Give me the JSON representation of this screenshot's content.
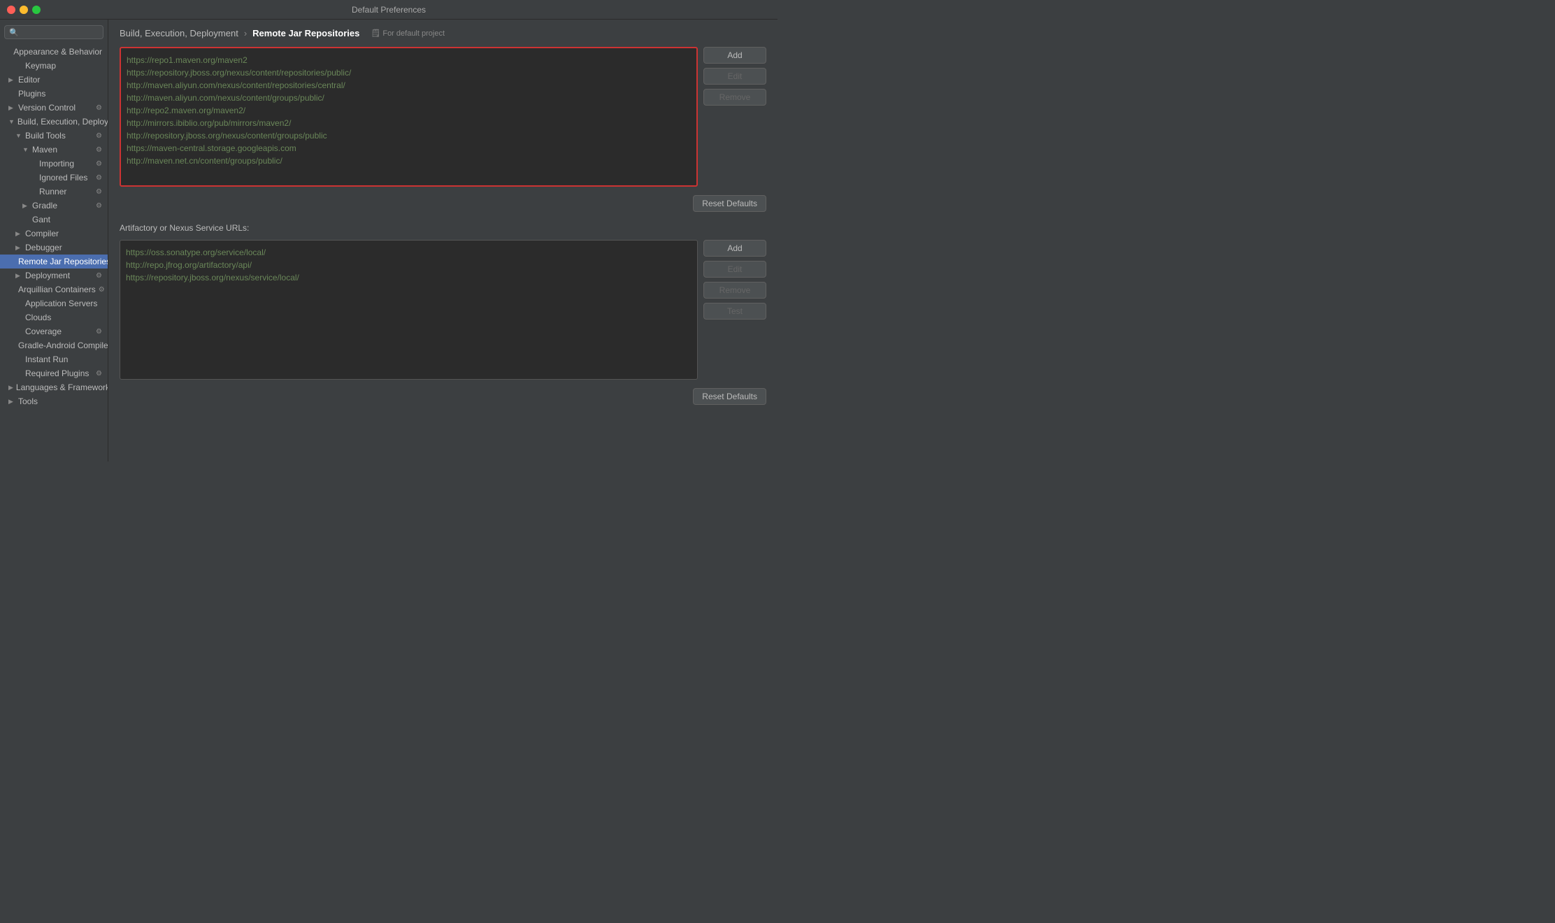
{
  "window": {
    "title": "Default Preferences"
  },
  "breadcrumb": {
    "parent": "Build, Execution, Deployment",
    "separator": "›",
    "current": "Remote Jar Repositories",
    "project_label": "🗒 For default project"
  },
  "sidebar": {
    "search_placeholder": "🔍",
    "items": [
      {
        "id": "appearance",
        "label": "Appearance & Behavior",
        "indent": 0,
        "arrow": "",
        "has_gear": false,
        "selected": false
      },
      {
        "id": "keymap",
        "label": "Keymap",
        "indent": 1,
        "arrow": "",
        "has_gear": false,
        "selected": false
      },
      {
        "id": "editor",
        "label": "Editor",
        "indent": 0,
        "arrow": "▶",
        "has_gear": false,
        "selected": false
      },
      {
        "id": "plugins",
        "label": "Plugins",
        "indent": 0,
        "arrow": "",
        "has_gear": false,
        "selected": false
      },
      {
        "id": "version-control",
        "label": "Version Control",
        "indent": 0,
        "arrow": "▶",
        "has_gear": true,
        "selected": false
      },
      {
        "id": "build-exec-deploy",
        "label": "Build, Execution, Deployment",
        "indent": 0,
        "arrow": "▼",
        "has_gear": false,
        "selected": false
      },
      {
        "id": "build-tools",
        "label": "Build Tools",
        "indent": 1,
        "arrow": "▼",
        "has_gear": true,
        "selected": false
      },
      {
        "id": "maven",
        "label": "Maven",
        "indent": 2,
        "arrow": "▼",
        "has_gear": true,
        "selected": false
      },
      {
        "id": "importing",
        "label": "Importing",
        "indent": 3,
        "arrow": "",
        "has_gear": true,
        "selected": false
      },
      {
        "id": "ignored-files",
        "label": "Ignored Files",
        "indent": 3,
        "arrow": "",
        "has_gear": true,
        "selected": false
      },
      {
        "id": "runner",
        "label": "Runner",
        "indent": 3,
        "arrow": "",
        "has_gear": true,
        "selected": false
      },
      {
        "id": "gradle",
        "label": "Gradle",
        "indent": 2,
        "arrow": "▶",
        "has_gear": true,
        "selected": false
      },
      {
        "id": "gant",
        "label": "Gant",
        "indent": 2,
        "arrow": "",
        "has_gear": false,
        "selected": false
      },
      {
        "id": "compiler",
        "label": "Compiler",
        "indent": 1,
        "arrow": "▶",
        "has_gear": false,
        "selected": false
      },
      {
        "id": "debugger",
        "label": "Debugger",
        "indent": 1,
        "arrow": "▶",
        "has_gear": false,
        "selected": false
      },
      {
        "id": "remote-jar",
        "label": "Remote Jar Repositories",
        "indent": 1,
        "arrow": "",
        "has_gear": true,
        "selected": true
      },
      {
        "id": "deployment",
        "label": "Deployment",
        "indent": 1,
        "arrow": "▶",
        "has_gear": true,
        "selected": false
      },
      {
        "id": "arquillian",
        "label": "Arquillian Containers",
        "indent": 1,
        "arrow": "",
        "has_gear": true,
        "selected": false
      },
      {
        "id": "app-servers",
        "label": "Application Servers",
        "indent": 1,
        "arrow": "",
        "has_gear": false,
        "selected": false
      },
      {
        "id": "clouds",
        "label": "Clouds",
        "indent": 1,
        "arrow": "",
        "has_gear": false,
        "selected": false
      },
      {
        "id": "coverage",
        "label": "Coverage",
        "indent": 1,
        "arrow": "",
        "has_gear": true,
        "selected": false
      },
      {
        "id": "gradle-android",
        "label": "Gradle-Android Compiler",
        "indent": 1,
        "arrow": "",
        "has_gear": true,
        "selected": false
      },
      {
        "id": "instant-run",
        "label": "Instant Run",
        "indent": 1,
        "arrow": "",
        "has_gear": false,
        "selected": false
      },
      {
        "id": "required-plugins",
        "label": "Required Plugins",
        "indent": 1,
        "arrow": "",
        "has_gear": true,
        "selected": false
      },
      {
        "id": "languages",
        "label": "Languages & Frameworks",
        "indent": 0,
        "arrow": "▶",
        "has_gear": false,
        "selected": false
      },
      {
        "id": "tools",
        "label": "Tools",
        "indent": 0,
        "arrow": "▶",
        "has_gear": false,
        "selected": false
      }
    ]
  },
  "repo_section": {
    "urls": [
      "https://repo1.maven.org/maven2",
      "https://repository.jboss.org/nexus/content/repositories/public/",
      "http://maven.aliyun.com/nexus/content/repositories/central/",
      "http://maven.aliyun.com/nexus/content/groups/public/",
      "http://repo2.maven.org/maven2/",
      "http://mirrors.ibiblio.org/pub/mirrors/maven2/",
      "http://repository.jboss.org/nexus/content/groups/public",
      "https://maven-central.storage.googleapis.com",
      "http://maven.net.cn/content/groups/public/"
    ],
    "buttons": {
      "add": "Add",
      "edit": "Edit",
      "remove": "Remove",
      "reset_defaults": "Reset Defaults"
    }
  },
  "artifactory_section": {
    "label": "Artifactory or Nexus Service URLs:",
    "urls": [
      "https://oss.sonatype.org/service/local/",
      "http://repo.jfrog.org/artifactory/api/",
      "https://repository.jboss.org/nexus/service/local/"
    ],
    "buttons": {
      "add": "Add",
      "edit": "Edit",
      "remove": "Remove",
      "test": "Test",
      "reset_defaults": "Reset Defaults"
    }
  }
}
